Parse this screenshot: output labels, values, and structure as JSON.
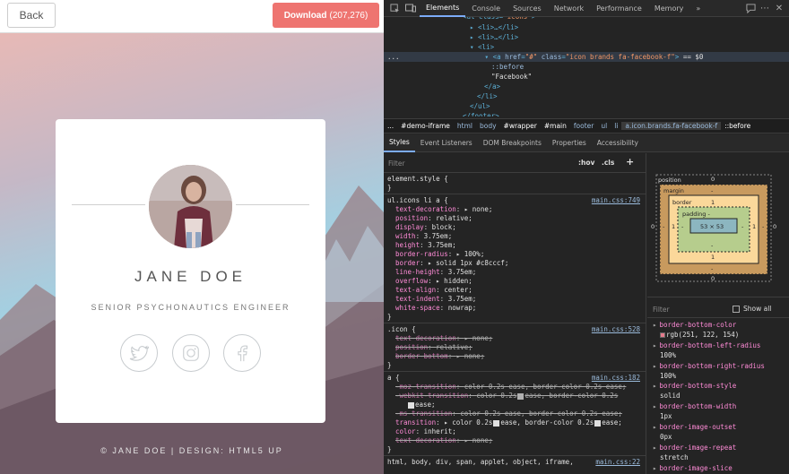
{
  "preview": {
    "back_label": "Back",
    "download_label": "Download",
    "download_count": "(207,276)",
    "card": {
      "name": "JANE DOE",
      "role": "SENIOR PSYCHONAUTICS ENGINEER",
      "social": [
        "twitter-icon",
        "instagram-icon",
        "facebook-icon"
      ]
    },
    "footer": "© JANE DOE | DESIGN: HTML5 UP"
  },
  "devtools": {
    "tabs": [
      "Elements",
      "Console",
      "Sources",
      "Network",
      "Performance",
      "Memory",
      "»"
    ],
    "active_tab": "Elements",
    "dom_lines": [
      {
        "indent": 6,
        "html": "<ul class=\"icons\">"
      },
      {
        "indent": 7,
        "html": "▸ <li>…</li>"
      },
      {
        "indent": 7,
        "html": "▸ <li>…</li>"
      },
      {
        "indent": 7,
        "html": "▾ <li>"
      },
      {
        "indent": 8,
        "html": "▾ <a href=\"#\" class=\"icon brands fa-facebook-f\"> == $0"
      },
      {
        "indent": 10,
        "html": "::before"
      },
      {
        "indent": 10,
        "html": "\"Facebook\""
      },
      {
        "indent": 9,
        "html": "</a>"
      },
      {
        "indent": 8,
        "html": "</li>"
      },
      {
        "indent": 7,
        "html": "</ul>"
      },
      {
        "indent": 6,
        "html": "</footer>"
      }
    ],
    "breadcrumbs": [
      "...",
      "#demo-iframe",
      "html",
      "body",
      "#wrapper",
      "#main",
      "footer",
      "ul",
      "li",
      "a.icon.brands.fa-facebook-f",
      "::before"
    ],
    "subtabs": [
      "Styles",
      "Event Listeners",
      "DOM Breakpoints",
      "Properties",
      "Accessibility"
    ],
    "filter_placeholder": "Filter",
    "hov": ":hov",
    "cls": ".cls",
    "plus": "+",
    "styles": {
      "element_style": "element.style {",
      "close": "}",
      "rule1": {
        "selector": "ul.icons li a {",
        "source": "main.css:749",
        "props": [
          [
            "text-decoration",
            "▸ none;"
          ],
          [
            "position",
            "relative;"
          ],
          [
            "display",
            "block;"
          ],
          [
            "width",
            "3.75em;"
          ],
          [
            "height",
            "3.75em;"
          ],
          [
            "border-radius",
            "▸ 100%;"
          ],
          [
            "border",
            "▸ solid 1px #c8cccf;"
          ],
          [
            "line-height",
            "3.75em;"
          ],
          [
            "overflow",
            "▸ hidden;"
          ],
          [
            "text-align",
            "center;"
          ],
          [
            "text-indent",
            "3.75em;"
          ],
          [
            "white-space",
            "nowrap;"
          ]
        ]
      },
      "rule2": {
        "selector": ".icon {",
        "source": "main.css:528",
        "props": [
          [
            "text-decoration",
            "▸ none;"
          ],
          [
            "position",
            "relative;"
          ],
          [
            "border-bottom",
            "▸ none;"
          ]
        ]
      },
      "rule3": {
        "selector": "a {",
        "source": "main.css:182",
        "props": [
          [
            "-moz-transition",
            "color 0.2s ease, border-color 0.2s ease;"
          ],
          [
            "-webkit-transition",
            "color 0.2s",
            "ease, border-color 0.2s",
            "ease;"
          ],
          [
            "-ms-transition",
            "color 0.2s ease, border-color 0.2s ease;"
          ],
          [
            "transition",
            "▸ color 0.2s",
            "ease, border-color 0.2s",
            "ease;"
          ],
          [
            "color",
            "inherit;"
          ],
          [
            "text-decoration",
            "▸ none;"
          ]
        ]
      },
      "rule4": {
        "selector": "html, body, div, span, applet, object, iframe,",
        "source": "main.css:22"
      }
    },
    "box_model": {
      "position_label": "position",
      "margin_label": "margin",
      "border_label": "border",
      "padding_label": "padding -",
      "position": "0",
      "margin": "-",
      "border": "1",
      "padding": "-",
      "content": "53 × 53",
      "zero": "0"
    },
    "computed_filter": "Filter",
    "show_all": "Show all",
    "computed": [
      {
        "name": "border-bottom-color",
        "value": "rgb(251, 122, 154)",
        "swatch": "#e57a8c"
      },
      {
        "name": "border-bottom-left-radius",
        "value": "100%"
      },
      {
        "name": "border-bottom-right-radius",
        "value": "100%"
      },
      {
        "name": "border-bottom-style",
        "value": "solid"
      },
      {
        "name": "border-bottom-width",
        "value": "1px"
      },
      {
        "name": "border-image-outset",
        "value": "0px"
      },
      {
        "name": "border-image-repeat",
        "value": "stretch"
      },
      {
        "name": "border-image-slice",
        "value": ""
      }
    ],
    "colors": {
      "accent": "#7cacf8",
      "download_bg": "#ee7470",
      "prop_name": "#ff8bd7",
      "tag": "#5db0d7",
      "border_swatch": "#c8cccf"
    }
  }
}
